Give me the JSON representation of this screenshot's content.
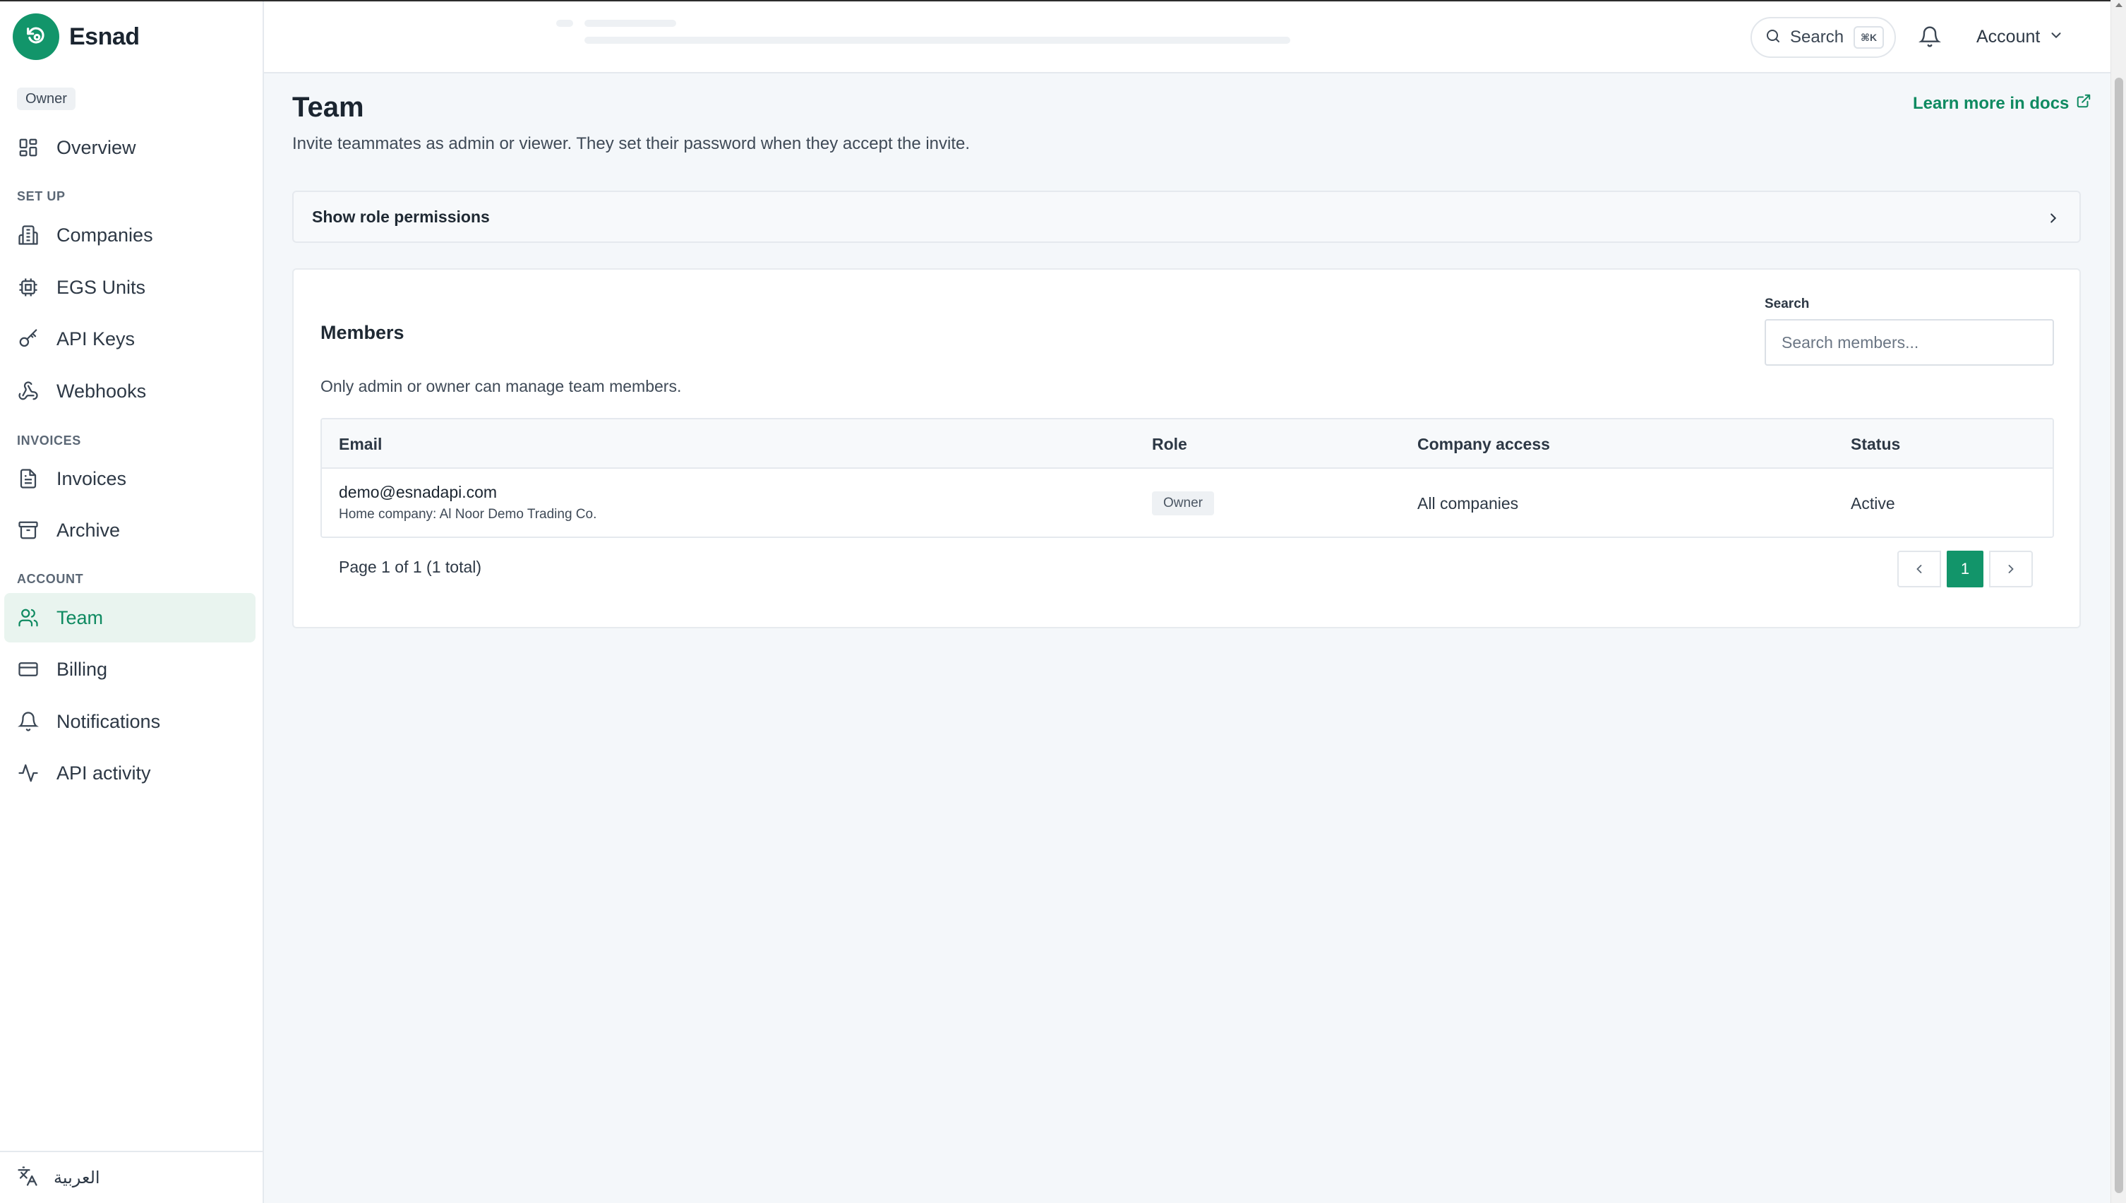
{
  "app": {
    "name": "Esnad",
    "role_badge": "Owner"
  },
  "sidebar": {
    "overview": "Overview",
    "sections": {
      "setup": "SET UP",
      "invoices": "INVOICES",
      "account": "ACCOUNT"
    },
    "items": {
      "companies": "Companies",
      "egs_units": "EGS Units",
      "api_keys": "API Keys",
      "webhooks": "Webhooks",
      "invoices": "Invoices",
      "archive": "Archive",
      "team": "Team",
      "billing": "Billing",
      "notifications": "Notifications",
      "api_activity": "API activity"
    },
    "active_item": "team",
    "language_label": "العربية"
  },
  "topbar": {
    "search_label": "Search",
    "search_shortcut": "⌘K",
    "account_label": "Account"
  },
  "page": {
    "title": "Team",
    "subtitle": "Invite teammates as admin or viewer. They set their password when they accept the invite.",
    "docs_link": "Learn more in docs",
    "permissions_toggle": "Show role permissions"
  },
  "members": {
    "title": "Members",
    "note": "Only admin or owner can manage team members.",
    "search_label": "Search",
    "search_placeholder": "Search members...",
    "columns": {
      "email": "Email",
      "role": "Role",
      "access": "Company access",
      "status": "Status"
    },
    "rows": [
      {
        "email": "demo@esnadapi.com",
        "home_company": "Home company: Al Noor Demo Trading Co.",
        "role": "Owner",
        "access": "All companies",
        "status": "Active"
      }
    ],
    "pagination": {
      "summary": "Page 1 of 1 (1 total)",
      "current_page": "1"
    }
  },
  "colors": {
    "accent": "#12956a",
    "active_bg": "#e9f4ef",
    "background": "#f4f7fa"
  },
  "icons": {
    "brand": "refresh-logo-icon",
    "overview": "grid-icon",
    "companies": "building-icon",
    "egs_units": "chip-icon",
    "api_keys": "key-icon",
    "webhooks": "webhook-icon",
    "invoices": "file-text-icon",
    "archive": "archive-box-icon",
    "team": "users-icon",
    "billing": "credit-card-icon",
    "notifications": "bell-icon",
    "api_activity": "activity-icon",
    "language": "translate-icon"
  }
}
